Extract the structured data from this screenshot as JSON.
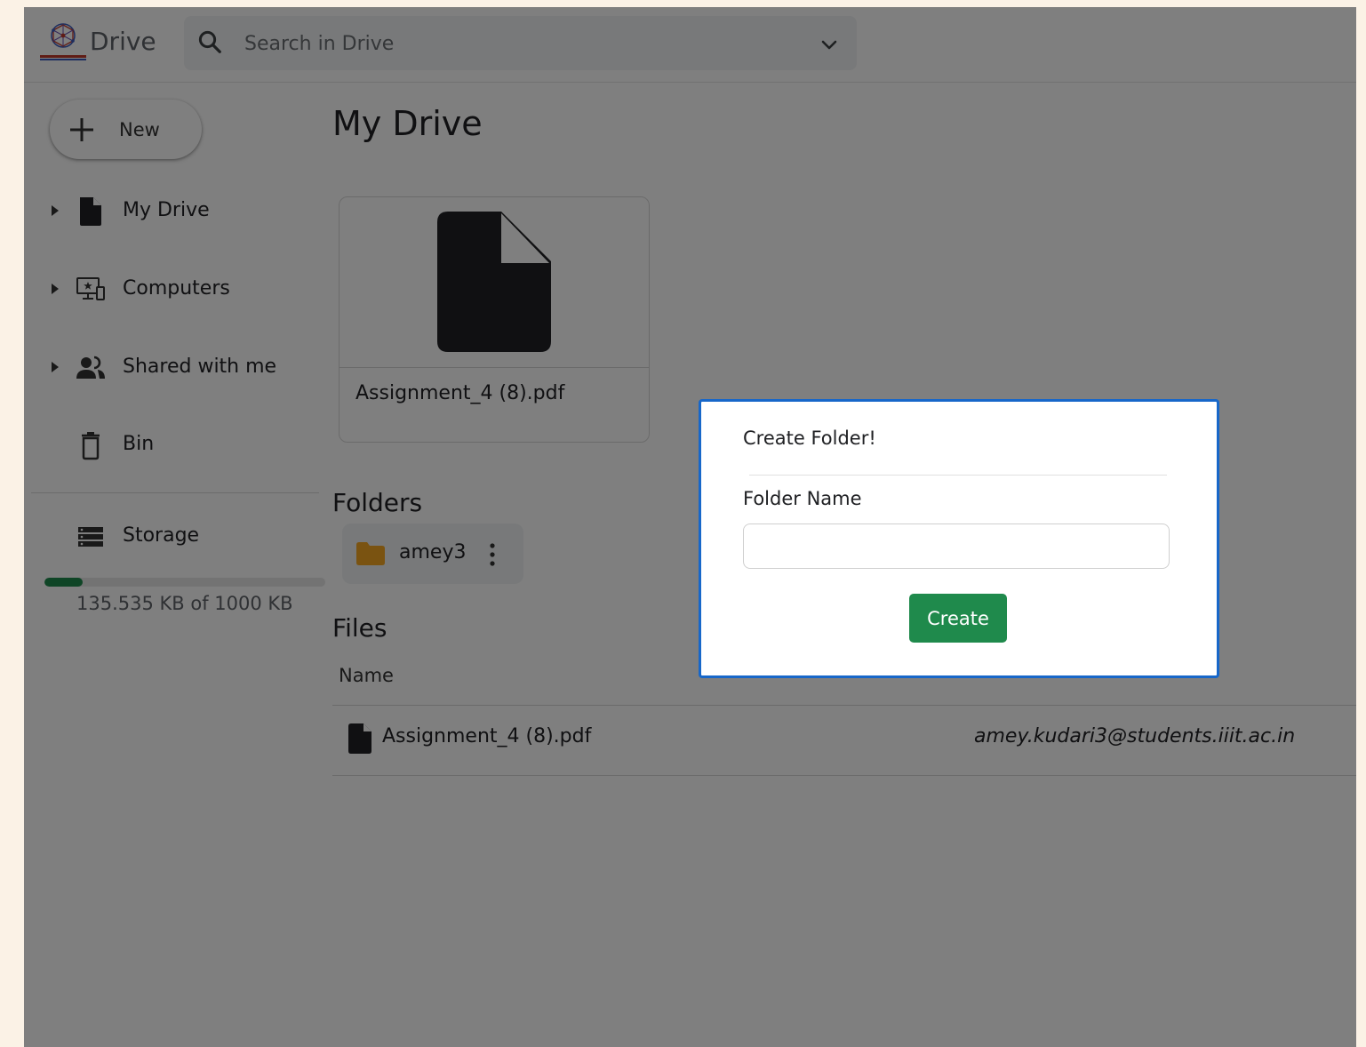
{
  "header": {
    "brand": "Drive",
    "search_placeholder": "Search in Drive"
  },
  "sidebar": {
    "new_label": "New",
    "items": [
      {
        "label": "My Drive",
        "icon": "file-icon"
      },
      {
        "label": "Computers",
        "icon": "computer-icon"
      },
      {
        "label": "Shared with me",
        "icon": "people-icon"
      },
      {
        "label": "Bin",
        "icon": "trash-icon"
      },
      {
        "label": "Storage",
        "icon": "storage-icon"
      }
    ],
    "storage": {
      "used_fraction": 0.135535,
      "text": "135.535 KB of 1000 KB"
    }
  },
  "main": {
    "title": "My Drive",
    "suggested_file": {
      "name": "Assignment_4 (8).pdf"
    },
    "folders_title": "Folders",
    "folders": [
      {
        "name": "amey3"
      }
    ],
    "files_title": "Files",
    "table": {
      "columns": [
        "Name"
      ],
      "rows": [
        {
          "name": "Assignment_4 (8).pdf",
          "owner": "amey.kudari3@students.iiit.ac.in"
        }
      ]
    }
  },
  "modal": {
    "title": "Create Folder!",
    "field_label": "Folder Name",
    "field_value": "",
    "button_label": "Create"
  },
  "colors": {
    "accent_green": "#1f8a4c",
    "modal_border": "#1767c9",
    "folder": "#f5a623",
    "page_background": "#fbf2e6"
  }
}
